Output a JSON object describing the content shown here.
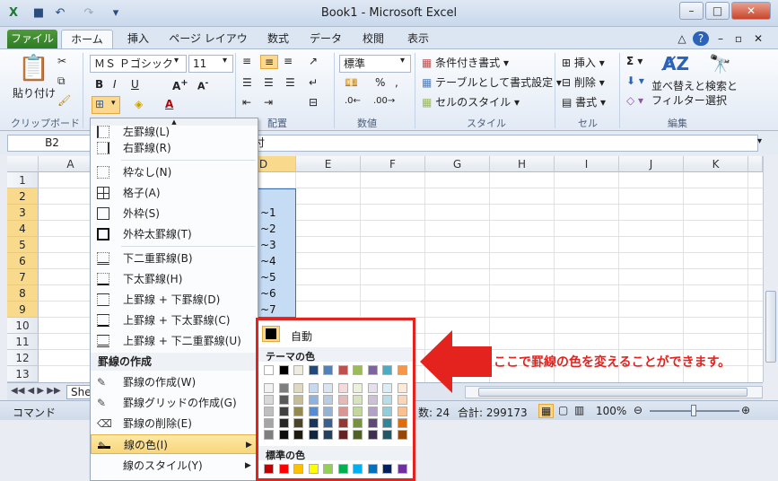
{
  "window": {
    "title": "Book1 - Microsoft Excel"
  },
  "tabs": [
    {
      "label": "ファイル"
    },
    {
      "label": "ホーム"
    },
    {
      "label": "挿入"
    },
    {
      "label": "ページ レイアウト"
    },
    {
      "label": "数式"
    },
    {
      "label": "データ"
    },
    {
      "label": "校閲"
    },
    {
      "label": "表示"
    }
  ],
  "ribbon": {
    "paste_label": "貼り付け",
    "clipboard_group": "クリップボード",
    "font_name": "ＭＳ Ｐゴシック",
    "font_size": "11",
    "alignment_group": "配置",
    "number_format": "標準",
    "number_group": "数値",
    "conditional_format": "条件付き書式",
    "format_as_table": "テーブルとして書式設定",
    "cell_styles": "セルのスタイル",
    "styles_group": "スタイル",
    "insert": "挿入",
    "delete": "削除",
    "format": "書式",
    "cells_group": "セル",
    "sort_filter": "並べ替えと",
    "sort_filter2": "フィルター",
    "find_select": "検索と",
    "find_select2": "選択",
    "editing_group": "編集"
  },
  "formula_bar": {
    "name_box": "B2",
    "content": "付"
  },
  "grid": {
    "columns": [
      "A",
      "D",
      "E",
      "F",
      "G",
      "H",
      "I",
      "J",
      "K"
    ],
    "rows": [
      "1",
      "2",
      "3",
      "4",
      "5",
      "6",
      "7",
      "8",
      "9",
      "10",
      "11",
      "12",
      "13"
    ],
    "d_values": [
      "",
      "",
      "~1",
      "~2",
      "~3",
      "~4",
      "~5",
      "~6",
      "~7"
    ]
  },
  "sheet_tab": "She",
  "status": {
    "mode": "コマンド",
    "count": "数: 24",
    "sum": "合計: 299173",
    "zoom": "100%"
  },
  "border_menu": {
    "items": [
      {
        "label": "左罫線(L)"
      },
      {
        "label": "右罫線(R)"
      },
      {
        "label": "枠なし(N)"
      },
      {
        "label": "格子(A)"
      },
      {
        "label": "外枠(S)"
      },
      {
        "label": "外枠太罫線(T)"
      },
      {
        "label": "下二重罫線(B)"
      },
      {
        "label": "下太罫線(H)"
      },
      {
        "label": "上罫線 + 下罫線(D)"
      },
      {
        "label": "上罫線 + 下太罫線(C)"
      },
      {
        "label": "上罫線 + 下二重罫線(U)"
      }
    ],
    "draw_header": "罫線の作成",
    "draw_items": [
      {
        "label": "罫線の作成(W)"
      },
      {
        "label": "罫線グリッドの作成(G)"
      },
      {
        "label": "罫線の削除(E)"
      },
      {
        "label": "線の色(I)"
      },
      {
        "label": "線のスタイル(Y)"
      }
    ]
  },
  "color_palette": {
    "auto_label": "自動",
    "theme_label": "テーマの色",
    "standard_label": "標準の色",
    "theme_top": [
      "#ffffff",
      "#000000",
      "#eeece1",
      "#1f497d",
      "#4f81bd",
      "#c0504d",
      "#9bbb59",
      "#8064a2",
      "#4bacc6",
      "#f79646"
    ],
    "theme_shades": [
      [
        "#f2f2f2",
        "#7f7f7f",
        "#ddd9c3",
        "#c6d9f0",
        "#dbe5f1",
        "#f2dcdb",
        "#ebf1dd",
        "#e5e0ec",
        "#dbeef3",
        "#fdeada"
      ],
      [
        "#d8d8d8",
        "#595959",
        "#c4bd97",
        "#8db3e2",
        "#b8cce4",
        "#e5b9b7",
        "#d7e3bc",
        "#ccc1d9",
        "#b7dde8",
        "#fbd5b5"
      ],
      [
        "#bfbfbf",
        "#3f3f3f",
        "#938953",
        "#548dd4",
        "#95b3d7",
        "#d99694",
        "#c3d69b",
        "#b2a2c7",
        "#92cddc",
        "#fac08f"
      ],
      [
        "#a5a5a5",
        "#262626",
        "#494429",
        "#17365d",
        "#366092",
        "#953734",
        "#76923c",
        "#5f497a",
        "#31859b",
        "#e36c09"
      ],
      [
        "#7f7f7f",
        "#0c0c0c",
        "#1d1b10",
        "#0f243e",
        "#244061",
        "#632423",
        "#4f6128",
        "#3f3151",
        "#205867",
        "#974806"
      ]
    ],
    "standard": [
      "#c00000",
      "#ff0000",
      "#ffc000",
      "#ffff00",
      "#92d050",
      "#00b050",
      "#00b0f0",
      "#0070c0",
      "#002060",
      "#7030a0"
    ]
  },
  "annotation": {
    "text": "ここで罫線の色を変えることができます。"
  },
  "colors": {
    "accent": "#e4231f",
    "selection": "#c6dcf5",
    "file_tab": "#2f7b25"
  }
}
